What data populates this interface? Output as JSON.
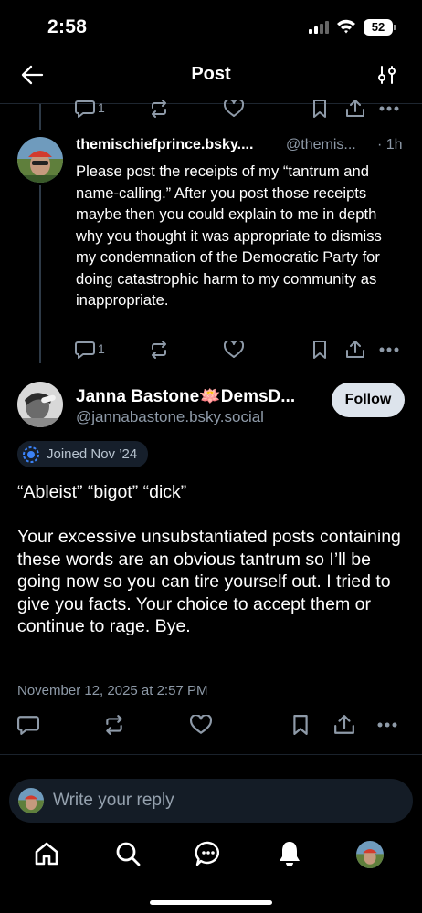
{
  "status_bar": {
    "time": "2:58",
    "battery": "52"
  },
  "header": {
    "title": "Post"
  },
  "parent_actions": {
    "reply_count": "1"
  },
  "reply": {
    "author_name": "themischiefprince.bsky....",
    "handle": "@themis...",
    "time": "· 1h",
    "text": "Please post the receipts of my “tantrum and name-calling.” After you post those receipts maybe then you could explain to me in depth why you thought it was appropriate to dismiss my condemnation of the Democratic Party for doing catastrophic harm to my community as inappropriate.",
    "reply_count": "1"
  },
  "main_post": {
    "author_name": "Janna Bastone🪷DemsD...",
    "handle": "@jannabastone.bsky.social",
    "follow_label": "Follow",
    "joined": "Joined Nov ’24",
    "text": "“Ableist” “bigot” “dick”\n\nYour excessive unsubstantiated posts containing these words are an obvious tantrum so I’ll be going now so you can tire yourself out. I tried to give you facts. Your choice to accept them or continue to rage. Bye.",
    "date": "November 12, 2025 at 2:57 PM"
  },
  "composer": {
    "placeholder": "Write your reply"
  },
  "icons": {
    "back": "arrow-left-icon",
    "filter": "sliders-icon",
    "reply": "speech-bubble-icon",
    "repost": "repost-icon",
    "like": "heart-icon",
    "bookmark": "bookmark-icon",
    "share": "share-icon",
    "more": "ellipsis-icon"
  },
  "colors": {
    "background": "#000000",
    "muted_text": "#8e9aa8",
    "follow_bg": "#dde4ec",
    "badge_bg": "#161f2b",
    "badge_icon": "#3b82f6"
  }
}
